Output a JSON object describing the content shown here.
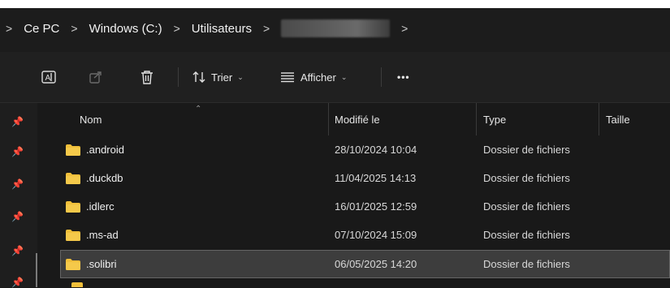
{
  "breadcrumb": {
    "leading_arrow": ">",
    "items": [
      "Ce PC",
      "Windows (C:)",
      "Utilisateurs",
      "",
      ""
    ],
    "separator": ">"
  },
  "toolbar": {
    "sort_label": "Trier",
    "view_label": "Afficher",
    "more_label": "•••"
  },
  "columns": {
    "name": "Nom",
    "modified": "Modifié le",
    "type": "Type",
    "size": "Taille"
  },
  "files": [
    {
      "name": ".android",
      "modified": "28/10/2024 10:04",
      "type": "Dossier de fichiers"
    },
    {
      "name": ".duckdb",
      "modified": "11/04/2025 14:13",
      "type": "Dossier de fichiers"
    },
    {
      "name": ".idlerc",
      "modified": "16/01/2025 12:59",
      "type": "Dossier de fichiers"
    },
    {
      "name": ".ms-ad",
      "modified": "07/10/2024 15:09",
      "type": "Dossier de fichiers"
    },
    {
      "name": ".solibri",
      "modified": "06/05/2025 14:20",
      "type": "Dossier de fichiers",
      "selected": true
    }
  ],
  "colors": {
    "folder": "#f0bf3a",
    "background": "#191919",
    "selection": "#3d3d3d"
  }
}
